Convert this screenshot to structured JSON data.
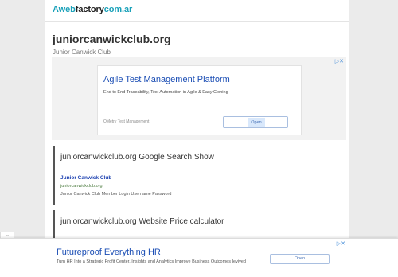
{
  "logo": {
    "part_a": "Aweb",
    "part_b": "factory",
    "part_c": "com.ar"
  },
  "site": {
    "title": "juniorcanwickclub.org",
    "subtitle": "Junior Canwick Club"
  },
  "ad_top": {
    "adchoices": "▷✕",
    "headline": "Agile Test Management Platform",
    "description": "End to End Traceability, Test Automation in Agile & Easy Cloning",
    "brand": "QMetry Test Management",
    "button": "Open"
  },
  "search_box": {
    "heading": "juniorcanwickclub.org Google Search Show",
    "result_title": "Junior Canwick Club",
    "result_url": "juniorcanwickclub.org",
    "result_snippet": "Junior Canwick Club Member Login Username Password"
  },
  "price_box": {
    "heading": "juniorcanwickclub.org Website Price calculator"
  },
  "ad_bottom": {
    "collapse_icon": "⌄",
    "adchoices": "▷✕",
    "headline": "Futureproof Everything HR",
    "description": "Turn HR Into a Strategic Profit Center. Insights and Analytics Improve Business Outcomes Ievived",
    "button": "Open"
  },
  "colors": {
    "accent": "#1aa1b9",
    "link": "#1a4db4",
    "box_border": "#555555"
  }
}
